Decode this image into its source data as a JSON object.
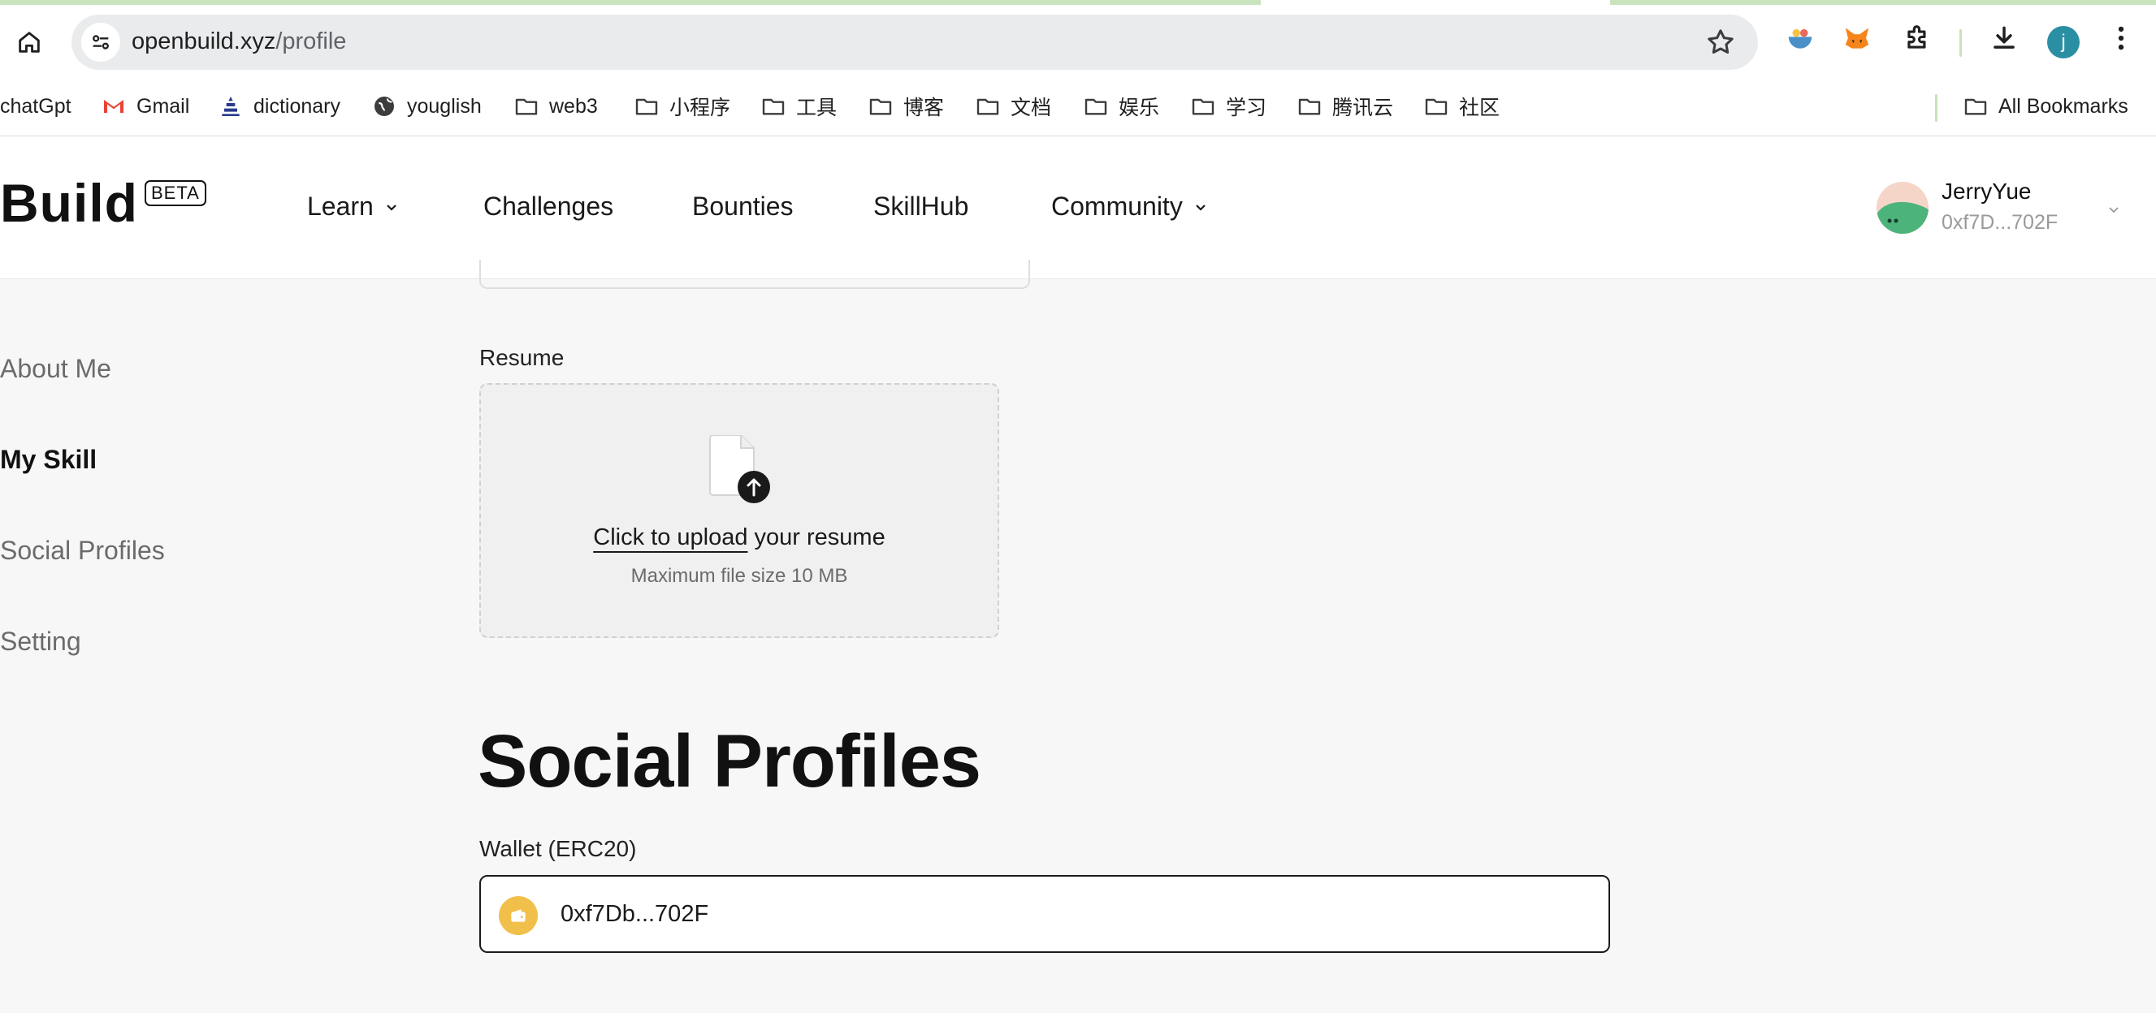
{
  "browser": {
    "url_host": "openbuild.xyz",
    "url_path": "/profile",
    "profile_initial": "j",
    "bookmarks": [
      {
        "label": "chatGpt",
        "icon": "chatgpt-icon"
      },
      {
        "label": "Gmail",
        "icon": "gmail-icon"
      },
      {
        "label": "dictionary",
        "icon": "dictionary-icon"
      },
      {
        "label": "youglish",
        "icon": "globe-icon"
      },
      {
        "label": "web3",
        "icon": "folder-icon"
      },
      {
        "label": "小程序",
        "icon": "folder-icon"
      },
      {
        "label": "工具",
        "icon": "folder-icon"
      },
      {
        "label": "博客",
        "icon": "folder-icon"
      },
      {
        "label": "文档",
        "icon": "folder-icon"
      },
      {
        "label": "娱乐",
        "icon": "folder-icon"
      },
      {
        "label": "学习",
        "icon": "folder-icon"
      },
      {
        "label": "腾讯云",
        "icon": "folder-icon"
      },
      {
        "label": "社区",
        "icon": "folder-icon"
      }
    ],
    "all_bookmarks": "All Bookmarks"
  },
  "header": {
    "logo": "Build",
    "beta": "BETA",
    "nav": [
      {
        "label": "Learn",
        "dropdown": true
      },
      {
        "label": "Challenges",
        "dropdown": false
      },
      {
        "label": "Bounties",
        "dropdown": false
      },
      {
        "label": "SkillHub",
        "dropdown": false
      },
      {
        "label": "Community",
        "dropdown": true
      }
    ],
    "user": {
      "name": "JerryYue",
      "address": "0xf7D...702F"
    }
  },
  "sidebar": {
    "items": [
      {
        "label": "About Me",
        "active": false
      },
      {
        "label": "My Skill",
        "active": true
      },
      {
        "label": "Social Profiles",
        "active": false
      },
      {
        "label": "Setting",
        "active": false
      }
    ]
  },
  "resume": {
    "label": "Resume",
    "upload_link": "Click to upload",
    "upload_rest": " your resume",
    "hint": "Maximum file size 10 MB"
  },
  "social": {
    "title": "Social Profiles",
    "wallet_label": "Wallet (ERC20)",
    "wallet_value": "0xf7Db...702F"
  },
  "colors": {
    "accent_tab": "#c8e3bd",
    "wallet_icon": "#f1c04a",
    "profile_dot": "#2b8fa3"
  }
}
